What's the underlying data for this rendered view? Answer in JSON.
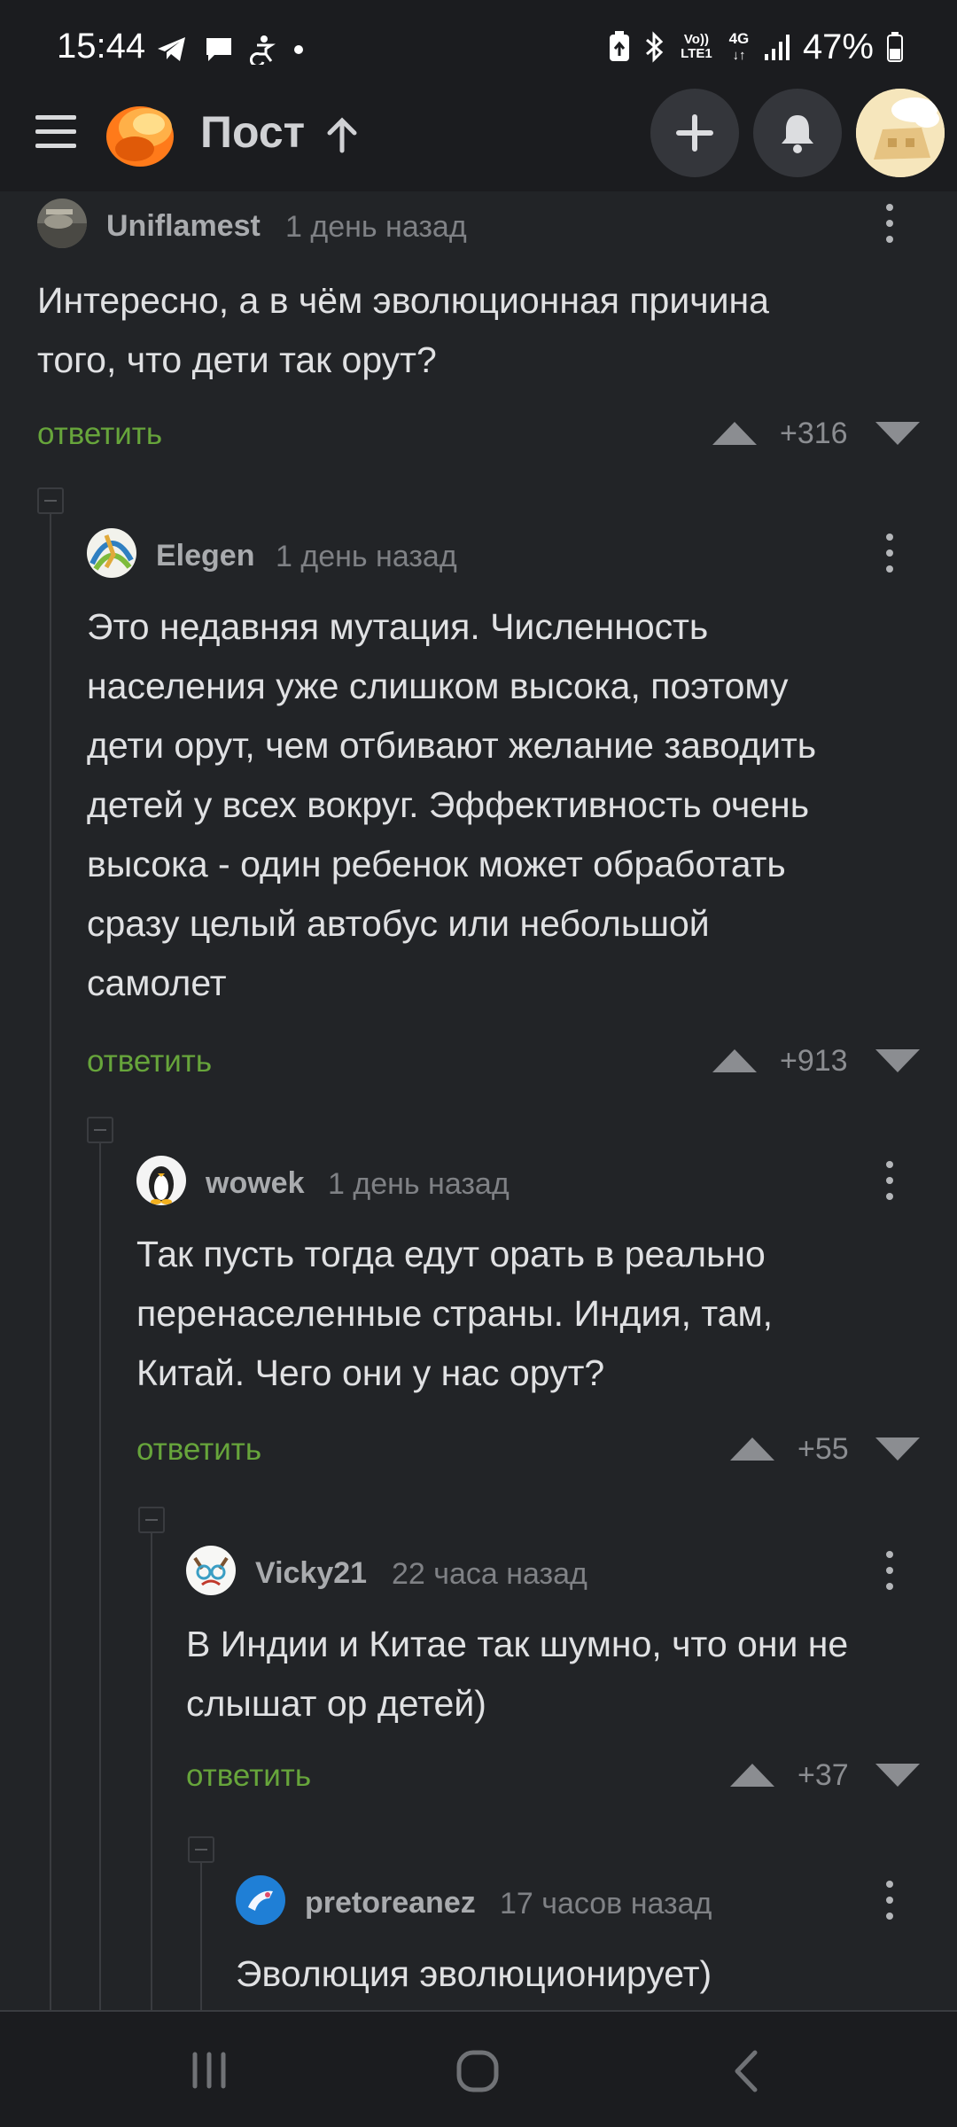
{
  "status_bar": {
    "time": "15:44",
    "left_icons": [
      "telegram-icon",
      "message-icon",
      "accessibility-icon",
      "dot-icon"
    ],
    "right_icons": [
      "battery-saver-icon",
      "bluetooth-icon",
      "volte-icon",
      "4g-icon",
      "signal-icon"
    ],
    "volte_label": "Vo)) LTE1",
    "network_label": "4G",
    "battery": "47%"
  },
  "header": {
    "title": "Пост",
    "icons": [
      "menu-icon",
      "logo-icon",
      "arrow-up-icon",
      "plus-icon",
      "bell-icon",
      "avatar"
    ]
  },
  "comments": [
    {
      "author": "Uniflamest",
      "time": "1 день назад",
      "text_lines": [
        "Интересно, а в чём эволюционная причина",
        "того, что дети так орут?"
      ],
      "reply": "ответить",
      "rating": "+316"
    },
    {
      "author": "Elegen",
      "time": "1 день назад",
      "text_lines": [
        "Это недавняя мутация. Численность",
        "населения уже слишком высока, поэтому",
        "дети орут, чем отбивают желание заводить",
        "детей у всех вокруг. Эффективность очень",
        "высока - один ребенок может обработать",
        "сразу целый автобус или небольшой",
        "самолет"
      ],
      "reply": "ответить",
      "rating": "+913"
    },
    {
      "author": "wowek",
      "time": "1 день назад",
      "text_lines": [
        "Так пусть тогда едут орать в реально",
        "перенаселенные страны. Индия, там,",
        "Китай. Чего они у нас орут?"
      ],
      "reply": "ответить",
      "rating": "+55"
    },
    {
      "author": "Vicky21",
      "time": "22 часа назад",
      "text_lines": [
        "В Индии и Китае так шумно, что они не",
        "слышат ор детей)"
      ],
      "reply": "ответить",
      "rating": "+37"
    },
    {
      "author": "pretoreanez",
      "time": "17 часов назад",
      "text_lines": [
        "Эволюция эволюционирует)"
      ],
      "reply": "",
      "rating": ""
    }
  ],
  "nav_bar": {
    "icons": [
      "recent-apps-icon",
      "home-icon",
      "back-icon"
    ]
  },
  "colors": {
    "background": "#222427",
    "header": "#1b1c1f",
    "reply_green": "#67a53b",
    "text": "#e0e1e3",
    "muted": "#7f8185"
  }
}
